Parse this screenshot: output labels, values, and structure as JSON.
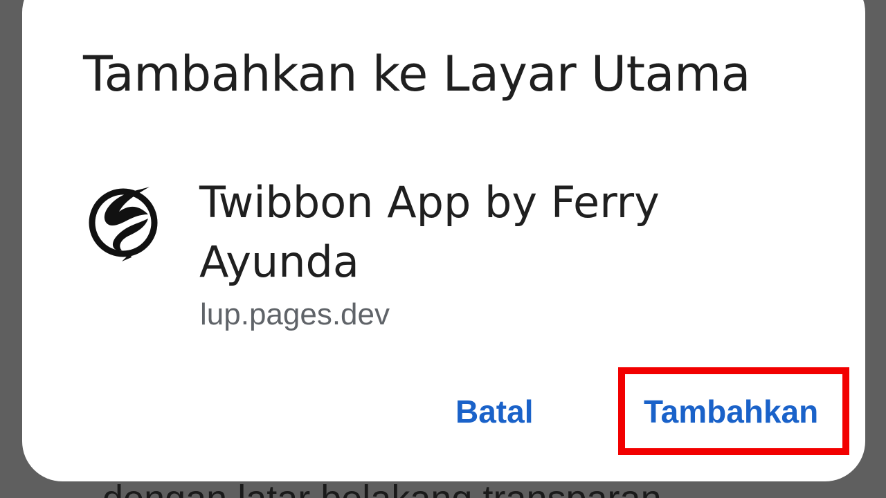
{
  "background": {
    "text": "dengan latar belakang transparan"
  },
  "dialog": {
    "title": "Tambahkan ke Layar Utama",
    "app": {
      "icon": "twibbon-logo-icon",
      "name": "Twibbon App by Ferry Ayunda",
      "url": "lup.pages.dev"
    },
    "buttons": {
      "cancel_label": "Batal",
      "add_label": "Tambahkan"
    },
    "highlighted_button": "Tambahkan"
  },
  "colors": {
    "accent": "#1a62c9",
    "highlight": "#f20000",
    "scrim": "#5f5f5f",
    "dialog_bg": "#ffffff"
  }
}
